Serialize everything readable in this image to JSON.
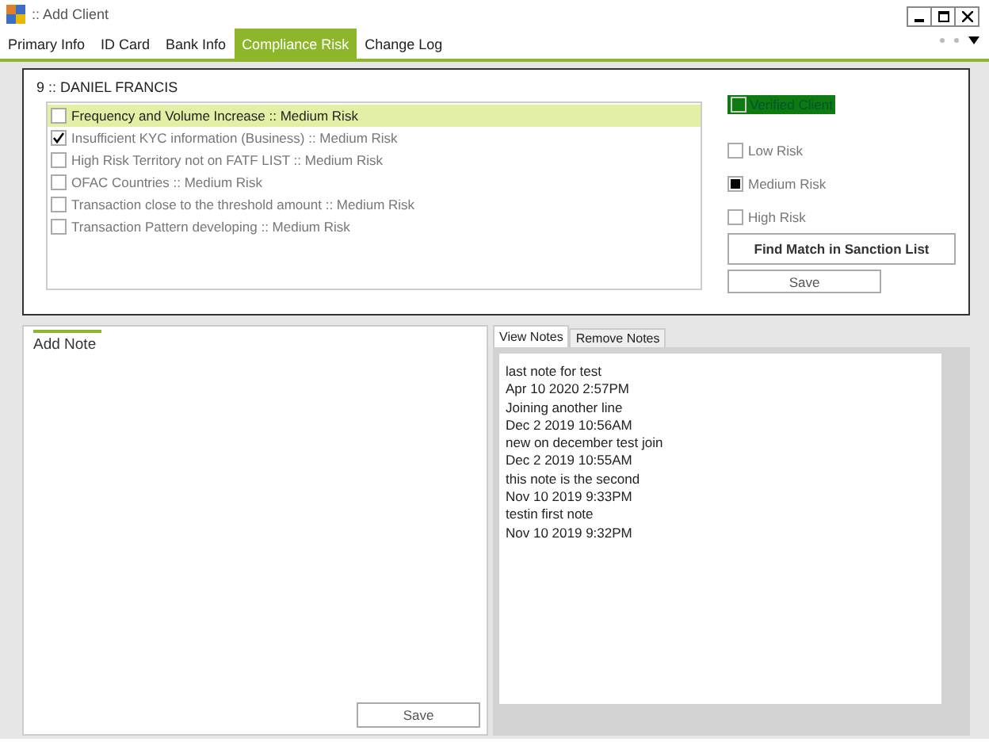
{
  "window": {
    "title": ":: Add Client"
  },
  "tabs": [
    {
      "label": "Primary Info",
      "selected": false
    },
    {
      "label": "ID Card",
      "selected": false
    },
    {
      "label": "Bank Info",
      "selected": false
    },
    {
      "label": "Compliance Risk",
      "selected": true
    },
    {
      "label": "Change Log",
      "selected": false
    }
  ],
  "client": {
    "heading": "9 :: DANIEL FRANCIS"
  },
  "risk_factors": [
    {
      "label": "Frequency and Volume Increase :: Medium Risk",
      "checked": false,
      "selected": true
    },
    {
      "label": "Insufficient KYC information (Business) :: Medium Risk",
      "checked": true,
      "selected": false
    },
    {
      "label": "High Risk Territory not on FATF LIST :: Medium Risk",
      "checked": false,
      "selected": false
    },
    {
      "label": "OFAC Countries :: Medium Risk",
      "checked": false,
      "selected": false
    },
    {
      "label": "Transaction close to the threshold amount  :: Medium Risk",
      "checked": false,
      "selected": false
    },
    {
      "label": "Transaction Pattern developing  :: Medium Risk",
      "checked": false,
      "selected": false
    }
  ],
  "verified_client": {
    "label": "Verified Client",
    "checked": false
  },
  "risk_levels": [
    {
      "label": "Low Risk",
      "selected": false
    },
    {
      "label": "Medium Risk",
      "selected": true
    },
    {
      "label": "High Risk",
      "selected": false
    }
  ],
  "find_match_button": "Find Match in Sanction List",
  "save_button": "Save",
  "add_note": {
    "title": "Add Note",
    "save_button": "Save"
  },
  "notes_tabs": [
    {
      "label": "View Notes",
      "selected": true
    },
    {
      "label": "Remove Notes",
      "selected": false
    }
  ],
  "notes": [
    "last note for test",
    "Apr 10 2020  2:57PM",
    "Joining another line",
    "Dec  2 2019 10:56AM",
    "new on december test join",
    "Dec  2 2019 10:55AM",
    "this note is the second",
    "Nov 10 2019  9:33PM",
    "testin first note",
    "Nov 10 2019  9:32PM"
  ]
}
